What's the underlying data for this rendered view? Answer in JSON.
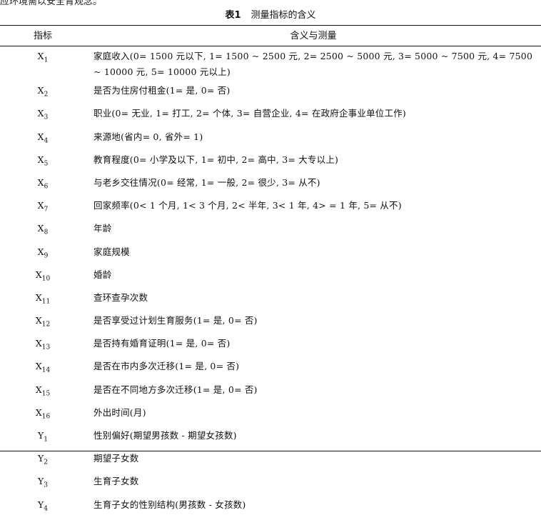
{
  "top_text": "应环境需以安全育观念。",
  "table": {
    "number": "表1",
    "title": "测量指标的含义",
    "headers": {
      "indicator": "指标",
      "description": "含义与测量"
    },
    "rows": [
      {
        "var": "X",
        "sub": "1",
        "desc": "家庭收入(0= 1500 元以下, 1= 1500 ~ 2500 元, 2= 2500 ~ 5000 元, 3= 5000 ~ 7500 元, 4= 7500 ~ 10000 元, 5= 10000 元以上)"
      },
      {
        "var": "X",
        "sub": "2",
        "desc": "是否为住房付租金(1= 是, 0= 否)"
      },
      {
        "var": "X",
        "sub": "3",
        "desc": "职业(0= 无业, 1= 打工, 2= 个体, 3= 自营企业, 4= 在政府企事业单位工作)"
      },
      {
        "var": "X",
        "sub": "4",
        "desc": "来源地(省内= 0, 省外= 1)"
      },
      {
        "var": "X",
        "sub": "5",
        "desc": "教育程度(0= 小学及以下, 1= 初中, 2= 高中, 3= 大专以上)"
      },
      {
        "var": "X",
        "sub": "6",
        "desc": "与老乡交往情况(0= 经常, 1= 一般, 2= 很少, 3= 从不)"
      },
      {
        "var": "X",
        "sub": "7",
        "desc": "回家频率(0< 1 个月, 1< 3 个月, 2< 半年, 3< 1 年, 4> = 1 年, 5= 从不)"
      },
      {
        "var": "X",
        "sub": "8",
        "desc": "年龄"
      },
      {
        "var": "X",
        "sub": "9",
        "desc": "家庭规模"
      },
      {
        "var": "X",
        "sub": "10",
        "desc": "婚龄"
      },
      {
        "var": "X",
        "sub": "11",
        "desc": "查环查孕次数"
      },
      {
        "var": "X",
        "sub": "12",
        "desc": "是否享受过计划生育服务(1= 是, 0= 否)"
      },
      {
        "var": "X",
        "sub": "13",
        "desc": "是否持有婚育证明(1= 是, 0= 否)"
      },
      {
        "var": "X",
        "sub": "14",
        "desc": "是否在市内多次迁移(1= 是, 0= 否)"
      },
      {
        "var": "X",
        "sub": "15",
        "desc": "是否在不同地方多次迁移(1= 是, 0= 否)"
      },
      {
        "var": "X",
        "sub": "16",
        "desc": "外出时间(月)"
      },
      {
        "var": "Y",
        "sub": "1",
        "desc": "性别偏好(期望男孩数 - 期望女孩数)"
      },
      {
        "var": "Y",
        "sub": "2",
        "desc": "期望子女数"
      },
      {
        "var": "Y",
        "sub": "3",
        "desc": "生育子女数"
      },
      {
        "var": "Y",
        "sub": "4",
        "desc": "生育子女的性别结构(男孩数 - 女孩数)"
      }
    ]
  }
}
